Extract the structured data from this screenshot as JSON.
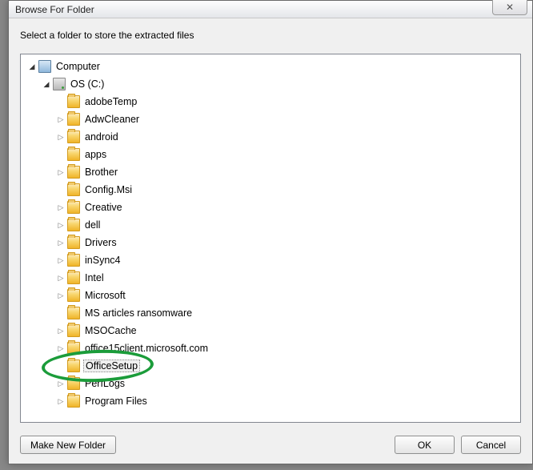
{
  "dialog": {
    "title": "Browse For Folder",
    "instruction": "Select a folder to store the extracted files"
  },
  "tree": {
    "root": {
      "label": "Computer",
      "icon": "computer",
      "expander": "open",
      "indent": 0
    },
    "drive": {
      "label": "OS (C:)",
      "icon": "drive",
      "expander": "open",
      "indent": 1
    },
    "items": [
      {
        "label": "adobeTemp",
        "expander": "none",
        "indent": 2
      },
      {
        "label": "AdwCleaner",
        "expander": "closed",
        "indent": 2
      },
      {
        "label": "android",
        "expander": "closed",
        "indent": 2
      },
      {
        "label": "apps",
        "expander": "none",
        "indent": 2
      },
      {
        "label": "Brother",
        "expander": "closed",
        "indent": 2
      },
      {
        "label": "Config.Msi",
        "expander": "none",
        "indent": 2
      },
      {
        "label": "Creative",
        "expander": "closed",
        "indent": 2
      },
      {
        "label": "dell",
        "expander": "closed",
        "indent": 2
      },
      {
        "label": "Drivers",
        "expander": "closed",
        "indent": 2
      },
      {
        "label": "inSync4",
        "expander": "closed",
        "indent": 2
      },
      {
        "label": "Intel",
        "expander": "closed",
        "indent": 2
      },
      {
        "label": "Microsoft",
        "expander": "closed",
        "indent": 2
      },
      {
        "label": "MS articles ransomware",
        "expander": "none",
        "indent": 2
      },
      {
        "label": "MSOCache",
        "expander": "closed",
        "indent": 2
      },
      {
        "label": "office15client.microsoft.com",
        "expander": "closed",
        "indent": 2
      },
      {
        "label": "OfficeSetup",
        "expander": "none",
        "indent": 2,
        "selected": true
      },
      {
        "label": "PerfLogs",
        "expander": "closed",
        "indent": 2
      },
      {
        "label": "Program Files",
        "expander": "closed",
        "indent": 2
      }
    ]
  },
  "buttons": {
    "make_new": "Make New Folder",
    "ok": "OK",
    "cancel": "Cancel"
  },
  "annotation": {
    "highlighted_item": "OfficeSetup",
    "highlight_color": "#1b9c3a"
  }
}
